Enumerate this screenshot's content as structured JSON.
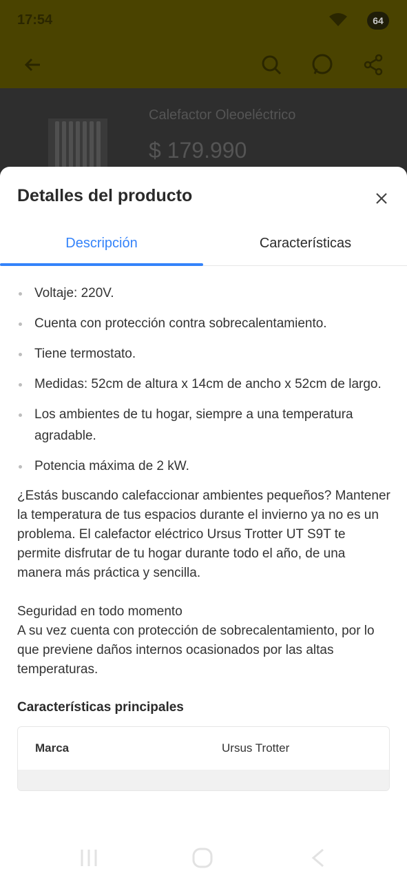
{
  "status_bar": {
    "time": "17:54",
    "battery": "64"
  },
  "background": {
    "product_title": "Calefactor Oleoeléctrico",
    "product_price": "$ 179.990"
  },
  "sheet": {
    "title": "Detalles del producto",
    "tabs": [
      {
        "label": "Descripción",
        "active": true
      },
      {
        "label": "Características",
        "active": false
      }
    ],
    "bullets": [
      "Voltaje: 220V.",
      "Cuenta con protección contra sobrecalentamiento.",
      "Tiene termostato.",
      "Medidas: 52cm de altura x 14cm  de ancho x 52cm de largo.",
      "Los ambientes de tu hogar, siempre a una temperatura agradable.",
      "Potencia máxima de 2 kW."
    ],
    "paragraph1": "¿Estás buscando calefaccionar ambientes pequeños? Mantener la temperatura de tus espacios durante el invierno ya no es un problema. El calefactor eléctrico Ursus Trotter UT S9T te permite disfrutar de tu hogar durante todo el año, de una manera más práctica y sencilla.",
    "paragraph2_title": "Seguridad en todo momento",
    "paragraph2_body": "A su vez cuenta con protección de sobrecalentamiento, por lo que previene daños internos ocasionados por las altas temperaturas.",
    "specs_title": "Características principales",
    "specs": [
      {
        "key": "Marca",
        "value": "Ursus Trotter"
      }
    ]
  },
  "colors": {
    "accent": "#3483fa",
    "header_dimmed": "#4a4300"
  }
}
